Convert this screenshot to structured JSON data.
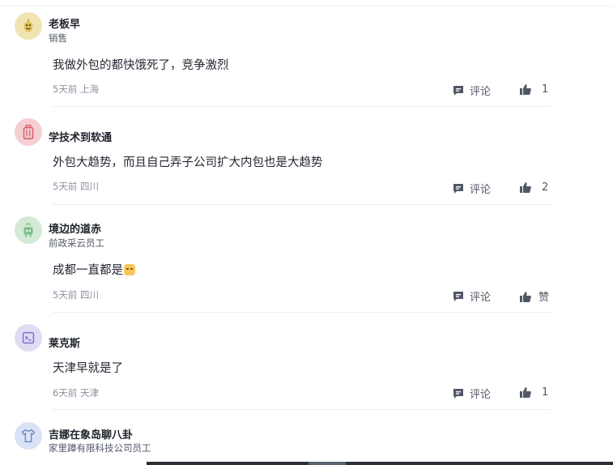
{
  "colors": {
    "avatar_yellow": "#f1e4b3",
    "avatar_red": "#f5cfd2",
    "avatar_green": "#d2ead6",
    "avatar_purple": "#dfdcf3",
    "avatar_blue": "#d9e3f5"
  },
  "actions": {
    "reply_label": "评论",
    "like_zero_label": "赞"
  },
  "comments": [
    {
      "avatar_icon": "mascot-icon",
      "username": "老板早",
      "title": "销售",
      "content": "我做外包的都快饿死了，竞争激烈",
      "meta": "5天前 上海",
      "likes": "1"
    },
    {
      "avatar_icon": "suitcase-icon",
      "username": "学技术到软通",
      "title": "",
      "content": "外包大趋势，而且自己弄子公司扩大内包也是大趋势",
      "meta": "5天前 四川",
      "likes": "2"
    },
    {
      "avatar_icon": "robot-icon",
      "username": "境边的道赤",
      "title": "前政采云员工",
      "content": "成都一直都是",
      "meta": "5天前 四川",
      "likes": "赞"
    },
    {
      "avatar_icon": "terminal-icon",
      "username": "莱克斯",
      "title": "",
      "content": "天津早就是了",
      "meta": "6天前 天津",
      "likes": "1"
    },
    {
      "avatar_icon": "tshirt-icon",
      "username": "吉娜在象岛聊八卦",
      "title": "家里蹲有限科技公司员工",
      "content": "",
      "meta": "",
      "likes": ""
    }
  ]
}
